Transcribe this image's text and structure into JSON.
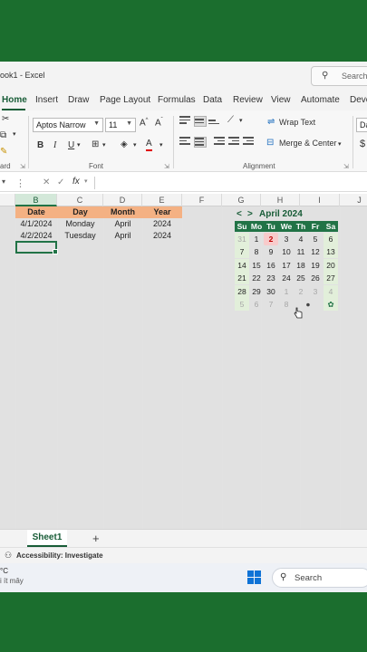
{
  "titlebar": {
    "title": "ook1  -  Excel",
    "search_placeholder": "Search"
  },
  "ribbon_tabs": [
    "Home",
    "Insert",
    "Draw",
    "Page Layout",
    "Formulas",
    "Data",
    "Review",
    "View",
    "Automate",
    "Deve"
  ],
  "ribbon": {
    "font_name": "Aptos Narrow",
    "font_size": "11",
    "grow_font": "A^",
    "shrink_font": "Aˇ",
    "bold": "B",
    "italic": "I",
    "underline": "U",
    "font_color": "A",
    "wrap_text": "Wrap Text",
    "merge_center": "Merge & Center",
    "number_format": "Da",
    "currency": "$",
    "group_clipboard": "ard",
    "group_font": "Font",
    "group_alignment": "Alignment"
  },
  "formula_bar": {
    "fx_label": "fx"
  },
  "columns": [
    "B",
    "C",
    "D",
    "E",
    "F",
    "G",
    "H",
    "I",
    "J"
  ],
  "table": {
    "headers": [
      "Date",
      "Day",
      "Month",
      "Year"
    ],
    "rows": [
      [
        "4/1/2024",
        "Monday",
        "April",
        "2024"
      ],
      [
        "4/2/2024",
        "Tuesday",
        "April",
        "2024"
      ]
    ]
  },
  "calendar": {
    "prev": "<",
    "next": ">",
    "title": "April 2024",
    "day_headers": [
      "Su",
      "Mo",
      "Tu",
      "We",
      "Th",
      "Fr",
      "Sa"
    ],
    "weeks": [
      [
        "31",
        "1",
        "2",
        "3",
        "4",
        "5",
        "6"
      ],
      [
        "7",
        "8",
        "9",
        "10",
        "11",
        "12",
        "13"
      ],
      [
        "14",
        "15",
        "16",
        "17",
        "18",
        "19",
        "20"
      ],
      [
        "21",
        "22",
        "23",
        "24",
        "25",
        "26",
        "27"
      ],
      [
        "28",
        "29",
        "30",
        "1",
        "2",
        "3",
        "4"
      ],
      [
        "5",
        "6",
        "7",
        "8",
        "",
        "",
        ""
      ]
    ],
    "info_icon": "●",
    "settings_icon": "✿"
  },
  "sheet_tabs": [
    "Sheet1"
  ],
  "add_sheet": "+",
  "status": {
    "accessibility": "Accessibility: Investigate"
  },
  "taskbar": {
    "weather_temp": "°C",
    "weather_desc": "i ít mây",
    "search_label": "Search"
  },
  "colors": {
    "excel_green": "#217346",
    "header_fill": "#f4b183",
    "today": "#c00000"
  }
}
